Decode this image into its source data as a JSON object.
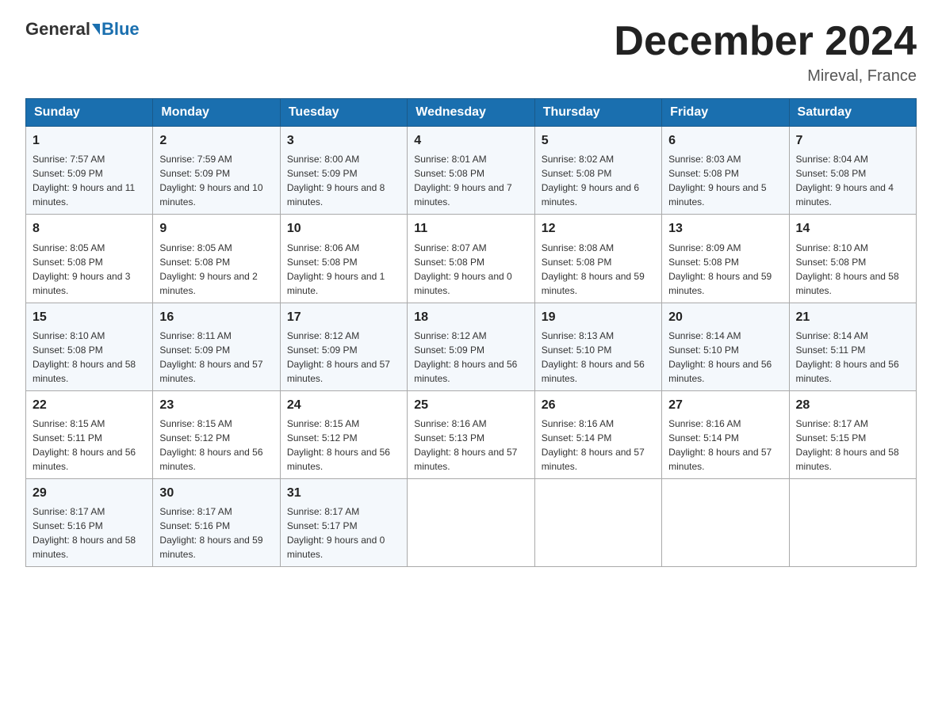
{
  "header": {
    "logo_general": "General",
    "logo_blue": "Blue",
    "month_title": "December 2024",
    "location": "Mireval, France"
  },
  "days_of_week": [
    "Sunday",
    "Monday",
    "Tuesday",
    "Wednesday",
    "Thursday",
    "Friday",
    "Saturday"
  ],
  "weeks": [
    [
      {
        "day": "1",
        "sunrise": "7:57 AM",
        "sunset": "5:09 PM",
        "daylight": "9 hours and 11 minutes."
      },
      {
        "day": "2",
        "sunrise": "7:59 AM",
        "sunset": "5:09 PM",
        "daylight": "9 hours and 10 minutes."
      },
      {
        "day": "3",
        "sunrise": "8:00 AM",
        "sunset": "5:09 PM",
        "daylight": "9 hours and 8 minutes."
      },
      {
        "day": "4",
        "sunrise": "8:01 AM",
        "sunset": "5:08 PM",
        "daylight": "9 hours and 7 minutes."
      },
      {
        "day": "5",
        "sunrise": "8:02 AM",
        "sunset": "5:08 PM",
        "daylight": "9 hours and 6 minutes."
      },
      {
        "day": "6",
        "sunrise": "8:03 AM",
        "sunset": "5:08 PM",
        "daylight": "9 hours and 5 minutes."
      },
      {
        "day": "7",
        "sunrise": "8:04 AM",
        "sunset": "5:08 PM",
        "daylight": "9 hours and 4 minutes."
      }
    ],
    [
      {
        "day": "8",
        "sunrise": "8:05 AM",
        "sunset": "5:08 PM",
        "daylight": "9 hours and 3 minutes."
      },
      {
        "day": "9",
        "sunrise": "8:05 AM",
        "sunset": "5:08 PM",
        "daylight": "9 hours and 2 minutes."
      },
      {
        "day": "10",
        "sunrise": "8:06 AM",
        "sunset": "5:08 PM",
        "daylight": "9 hours and 1 minute."
      },
      {
        "day": "11",
        "sunrise": "8:07 AM",
        "sunset": "5:08 PM",
        "daylight": "9 hours and 0 minutes."
      },
      {
        "day": "12",
        "sunrise": "8:08 AM",
        "sunset": "5:08 PM",
        "daylight": "8 hours and 59 minutes."
      },
      {
        "day": "13",
        "sunrise": "8:09 AM",
        "sunset": "5:08 PM",
        "daylight": "8 hours and 59 minutes."
      },
      {
        "day": "14",
        "sunrise": "8:10 AM",
        "sunset": "5:08 PM",
        "daylight": "8 hours and 58 minutes."
      }
    ],
    [
      {
        "day": "15",
        "sunrise": "8:10 AM",
        "sunset": "5:08 PM",
        "daylight": "8 hours and 58 minutes."
      },
      {
        "day": "16",
        "sunrise": "8:11 AM",
        "sunset": "5:09 PM",
        "daylight": "8 hours and 57 minutes."
      },
      {
        "day": "17",
        "sunrise": "8:12 AM",
        "sunset": "5:09 PM",
        "daylight": "8 hours and 57 minutes."
      },
      {
        "day": "18",
        "sunrise": "8:12 AM",
        "sunset": "5:09 PM",
        "daylight": "8 hours and 56 minutes."
      },
      {
        "day": "19",
        "sunrise": "8:13 AM",
        "sunset": "5:10 PM",
        "daylight": "8 hours and 56 minutes."
      },
      {
        "day": "20",
        "sunrise": "8:14 AM",
        "sunset": "5:10 PM",
        "daylight": "8 hours and 56 minutes."
      },
      {
        "day": "21",
        "sunrise": "8:14 AM",
        "sunset": "5:11 PM",
        "daylight": "8 hours and 56 minutes."
      }
    ],
    [
      {
        "day": "22",
        "sunrise": "8:15 AM",
        "sunset": "5:11 PM",
        "daylight": "8 hours and 56 minutes."
      },
      {
        "day": "23",
        "sunrise": "8:15 AM",
        "sunset": "5:12 PM",
        "daylight": "8 hours and 56 minutes."
      },
      {
        "day": "24",
        "sunrise": "8:15 AM",
        "sunset": "5:12 PM",
        "daylight": "8 hours and 56 minutes."
      },
      {
        "day": "25",
        "sunrise": "8:16 AM",
        "sunset": "5:13 PM",
        "daylight": "8 hours and 57 minutes."
      },
      {
        "day": "26",
        "sunrise": "8:16 AM",
        "sunset": "5:14 PM",
        "daylight": "8 hours and 57 minutes."
      },
      {
        "day": "27",
        "sunrise": "8:16 AM",
        "sunset": "5:14 PM",
        "daylight": "8 hours and 57 minutes."
      },
      {
        "day": "28",
        "sunrise": "8:17 AM",
        "sunset": "5:15 PM",
        "daylight": "8 hours and 58 minutes."
      }
    ],
    [
      {
        "day": "29",
        "sunrise": "8:17 AM",
        "sunset": "5:16 PM",
        "daylight": "8 hours and 58 minutes."
      },
      {
        "day": "30",
        "sunrise": "8:17 AM",
        "sunset": "5:16 PM",
        "daylight": "8 hours and 59 minutes."
      },
      {
        "day": "31",
        "sunrise": "8:17 AM",
        "sunset": "5:17 PM",
        "daylight": "9 hours and 0 minutes."
      },
      null,
      null,
      null,
      null
    ]
  ]
}
